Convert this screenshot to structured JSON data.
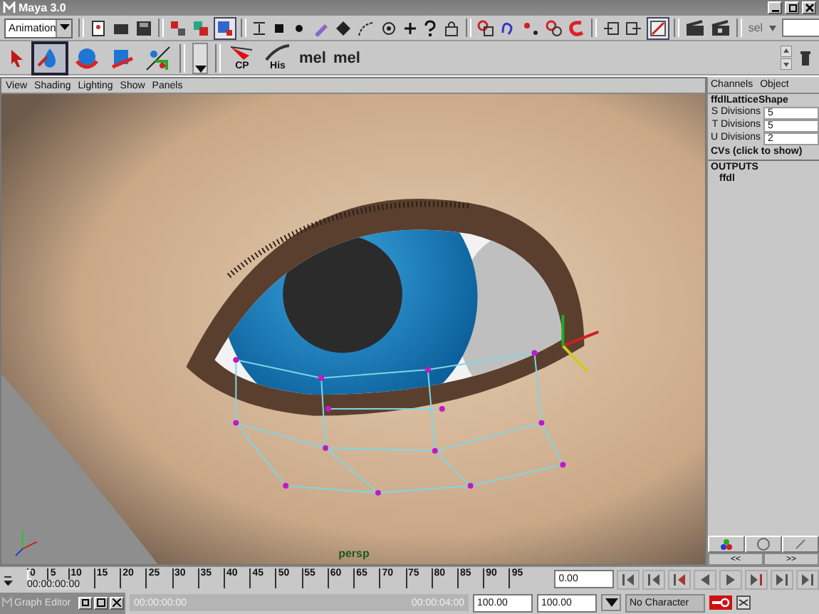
{
  "window": {
    "title": "Maya 3.0"
  },
  "toolbar": {
    "menu_set": "Animation",
    "sel_label": "sel"
  },
  "shelf": {
    "labels": [
      "CP",
      "His",
      "mel",
      "mel"
    ]
  },
  "panel_menu": [
    "View",
    "Shading",
    "Lighting",
    "Show",
    "Panels"
  ],
  "viewport": {
    "camera": "persp"
  },
  "channel_box": {
    "menu": [
      "Channels",
      "Object"
    ],
    "node": "ffdlLatticeShape",
    "attributes": [
      {
        "name": "S Divisions",
        "value": "5"
      },
      {
        "name": "T Divisions",
        "value": "5"
      },
      {
        "name": "U Divisions",
        "value": "2"
      }
    ],
    "cvs": "CVs (click to show)",
    "outputs_header": "OUTPUTS",
    "outputs": [
      "ffdl"
    ],
    "page_buttons": [
      "<<",
      ">>"
    ]
  },
  "timeline": {
    "ticks": [
      "0",
      "5",
      "10",
      "15",
      "20",
      "25",
      "30",
      "35",
      "40",
      "45",
      "50",
      "55",
      "60",
      "65",
      "70",
      "75",
      "80",
      "85",
      "90",
      "95"
    ],
    "current_time": "00:00:00:00",
    "current_frame": "0.00",
    "level": 0
  },
  "range_bar": {
    "level": 1,
    "start_time": "00:00:00:00",
    "end_time": "00:00:04:00",
    "range_end": "100.00",
    "anim_end": "100.00",
    "character": "No Character"
  },
  "graph_editor": {
    "title": "Graph Editor"
  }
}
